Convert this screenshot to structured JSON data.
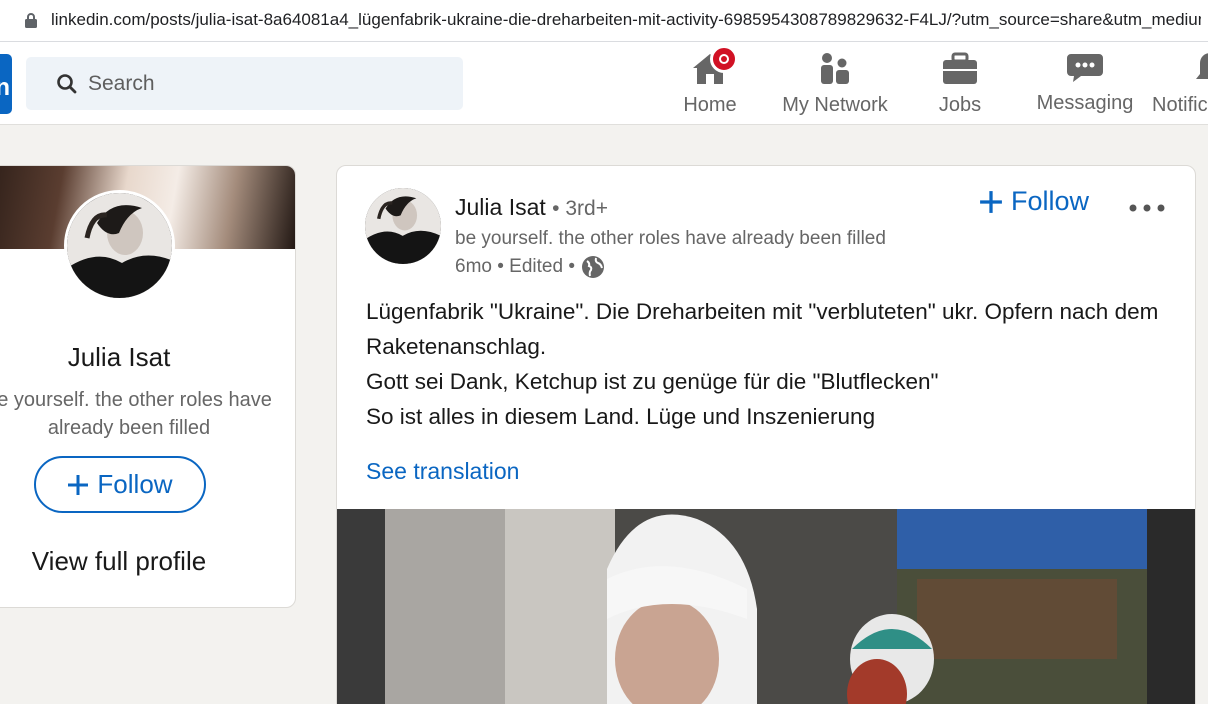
{
  "browser": {
    "url": "linkedin.com/posts/julia-isat-8a64081a4_lügenfabrik-ukraine-die-dreharbeiten-mit-activity-6985954308789829632-F4LJ/?utm_source=share&utm_medium=member_desktop"
  },
  "nav": {
    "search_placeholder": "Search",
    "items": [
      {
        "label": "Home"
      },
      {
        "label": "My Network"
      },
      {
        "label": "Jobs"
      },
      {
        "label": "Messaging"
      },
      {
        "label": "Notifications"
      }
    ]
  },
  "profile_card": {
    "name": "Julia Isat",
    "headline": "be yourself. the other roles have already been filled",
    "follow_label": "Follow",
    "view_profile_label": "View full profile"
  },
  "post": {
    "author": "Julia Isat",
    "degree": "• 3rd+",
    "headline": "be yourself. the other roles have already been filled",
    "meta": "6mo • Edited •",
    "follow_label": "Follow",
    "more_label": "•••",
    "text_lines": [
      "Lügenfabrik \"Ukraine\". Die Dreharbeiten mit \"verbluteten\" ukr. Opfern nach dem Raketenanschlag.",
      "Gott sei Dank, Ketchup ist zu genüge für die \"Blutflecken\"",
      "So ist alles in diesem Land. Lüge und Inszenierung"
    ],
    "see_translation": "See translation"
  },
  "colors": {
    "brand": "#0a66c2",
    "badge": "#d11124",
    "muted_text": "#666666",
    "background": "#f3f2ef"
  }
}
